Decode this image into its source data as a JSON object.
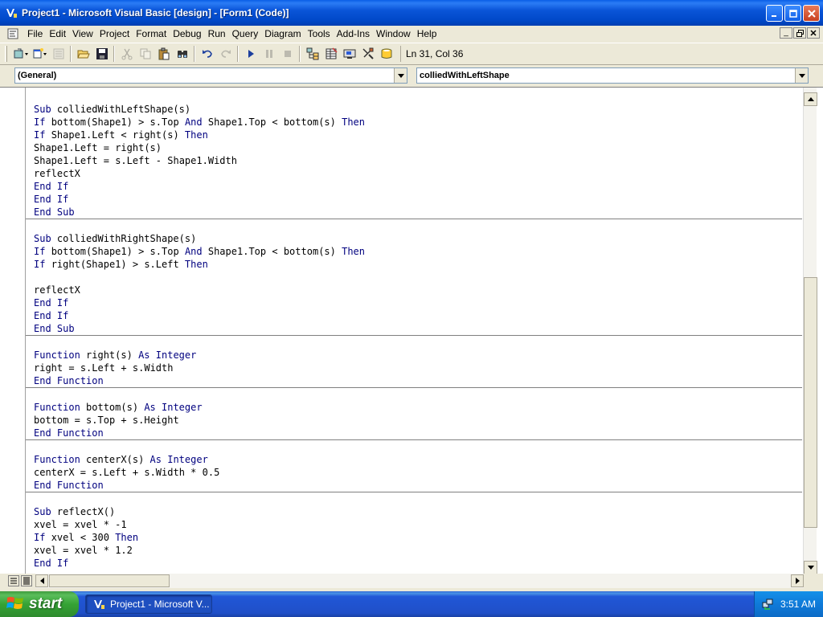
{
  "window": {
    "title": "Project1 - Microsoft Visual Basic [design] - [Form1 (Code)]"
  },
  "menubar": {
    "items": [
      "File",
      "Edit",
      "View",
      "Project",
      "Format",
      "Debug",
      "Run",
      "Query",
      "Diagram",
      "Tools",
      "Add-Ins",
      "Window",
      "Help"
    ]
  },
  "toolbar": {
    "cursor_position": "Ln 31, Col 36"
  },
  "combos": {
    "object": "(General)",
    "procedure": "colliedWithLeftShape"
  },
  "code": {
    "lines": [
      "Sub colliedWithLeftShape(s)",
      "If bottom(Shape1) > s.Top And Shape1.Top < bottom(s) Then",
      "If Shape1.Left < right(s) Then",
      "Shape1.Left = right(s)",
      "Shape1.Left = s.Left - Shape1.Width",
      "reflectX",
      "End If",
      "End If",
      "End Sub",
      "Sub colliedWithRightShape(s)",
      "If bottom(Shape1) > s.Top And Shape1.Top < bottom(s) Then",
      "If right(Shape1) > s.Left Then",
      "",
      "reflectX",
      "End If",
      "End If",
      "End Sub",
      "Function right(s) As Integer",
      "right = s.Left + s.Width",
      "End Function",
      "Function bottom(s) As Integer",
      "bottom = s.Top + s.Height",
      "End Function",
      "Function centerX(s) As Integer",
      "centerX = s.Left + s.Width * 0.5",
      "End Function",
      "Sub reflectX()",
      "xvel = xvel * -1",
      "If xvel < 300 Then",
      "xvel = xvel * 1.2",
      "End If"
    ]
  },
  "taskbar": {
    "start_label": "start",
    "task_label": "Project1 - Microsoft V...",
    "clock": "3:51 AM"
  }
}
